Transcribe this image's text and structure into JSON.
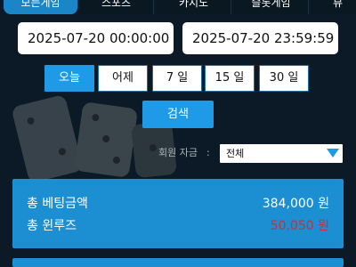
{
  "tabs": [
    {
      "label": "모든게임",
      "active": true
    },
    {
      "label": "스포츠",
      "active": false
    },
    {
      "label": "카지노",
      "active": false
    },
    {
      "label": "슬롯게임",
      "active": false
    },
    {
      "label": "뷰",
      "active": false
    }
  ],
  "date_range": {
    "start": "2025-07-20 00:00:00",
    "end": "2025-07-20 23:59:59"
  },
  "quick_ranges": [
    {
      "label": "오늘",
      "active": true
    },
    {
      "label": "어제",
      "active": false
    },
    {
      "label": "7 일",
      "active": false
    },
    {
      "label": "15 일",
      "active": false
    },
    {
      "label": "30 일",
      "active": false
    }
  ],
  "search_button": "검색",
  "filter": {
    "label": "회원 자금",
    "colon": ":",
    "selected": "전체"
  },
  "summary": {
    "total_bet_label": "총 베팅금액",
    "total_bet_value": "384,000 원",
    "total_winloss_label": "총 윈루즈",
    "total_winloss_value": "50,050 원"
  },
  "colors": {
    "accent": "#1e9ae6",
    "panel": "#1c8fd3",
    "negative": "#c1323a",
    "background": "#0b1a26"
  }
}
